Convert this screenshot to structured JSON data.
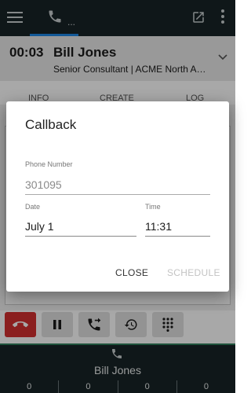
{
  "topbar": {
    "menu_icon": "hamburger-menu-icon",
    "phone_tab_icon": "phone-icon",
    "phone_tab_dots": "...",
    "popout_icon": "open-in-new-icon",
    "more_icon": "more-vert-icon"
  },
  "call": {
    "timer": "00:03",
    "caller_name": "Bill Jones",
    "caller_title": "Senior Consultant | ACME North America"
  },
  "tabs": [
    "INFO",
    "CREATE",
    "LOG"
  ],
  "dialog": {
    "title": "Callback",
    "phone_label": "Phone Number",
    "phone_value": "301095",
    "date_label": "Date",
    "date_value": "July 1",
    "time_label": "Time",
    "time_value": "11:31",
    "close_label": "CLOSE",
    "schedule_label": "SCHEDULE"
  },
  "actions": [
    "hangup-icon",
    "pause-icon",
    "transfer-call-icon",
    "history-icon",
    "dialpad-icon"
  ],
  "bottom": {
    "name": "Bill Jones",
    "counters": [
      "0",
      "0",
      "0",
      "0"
    ]
  },
  "colors": {
    "bar_bg": "#182326",
    "accent": "#1e88e5",
    "hangup": "#d32f2f"
  }
}
